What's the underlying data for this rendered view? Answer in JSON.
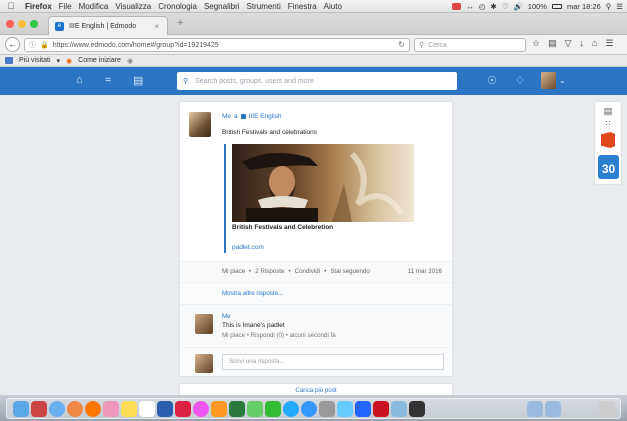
{
  "menubar": {
    "apple": "",
    "items": [
      "Firefox",
      "File",
      "Modifica",
      "Visualizza",
      "Cronologia",
      "Segnalibri",
      "Strumenti",
      "Finestra",
      "Aiuto"
    ],
    "battery": "100%",
    "clock": "mar 18:26"
  },
  "browser": {
    "tab_title": "IIIE English | Edmodo",
    "url": "https://www.edmodo.com/home#/group?id=19219425",
    "search_placeholder": "Cerca",
    "bookmarks": [
      "Più visitati",
      "Come iniziare"
    ]
  },
  "edmodo": {
    "search_placeholder": "Search posts, groups, users and more",
    "post": {
      "author": "Me",
      "to": "a",
      "group": "IIIE English",
      "text": "British Festivals and celebrations",
      "link_title": "British Festivals and Celebretion",
      "link_url": "padlet.com",
      "actions": [
        "Mi piace",
        "•",
        "2 Risposte",
        "•",
        "Condividi",
        "•",
        "Stai seguendo"
      ],
      "date": "11 mar 2016",
      "show_more": "Mostra altre risposte...",
      "reply": {
        "name": "Me",
        "text": "This is Imane's padlet",
        "meta": "Mi piace  •  Rispondi (0)  •  alcuni secondi fa"
      },
      "compose_placeholder": "Scrivi una risposta..."
    },
    "load_more": "Carica più post",
    "calendar_day": "30"
  },
  "colors": {
    "brand": "#2b75c3",
    "office": "#e0451c"
  }
}
